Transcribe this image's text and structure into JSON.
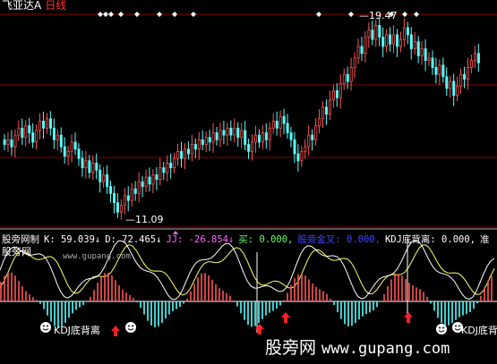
{
  "header": {
    "stock_name": "飞亚达A",
    "period": "日线"
  },
  "price": {
    "high_label": "19.47",
    "low_label": "11.09"
  },
  "indicator": {
    "name": "股旁网制",
    "k": "K: 59.039↓",
    "d": "D: 72.465↓",
    "jj": "JJ: -26.854↓",
    "buy": "买: 0.000,",
    "golden": "股旁金叉: 0.000,",
    "diverge": "KDJ底背离: 0.000,",
    "trail": "准",
    "sub_title": "股旁网",
    "site": "www.gupang.com"
  },
  "signals": {
    "left_label": "KDJ底背离",
    "right_label": "KDJ底背"
  },
  "watermark": {
    "cn": "股旁网",
    "url": "www.gupang.com"
  },
  "colors": {
    "up": "#ff5555",
    "down": "#55ffff",
    "k_line": "#ffffff",
    "d_line": "#ffff66",
    "grid": "#8b0000",
    "k_text": "#ffffff",
    "d_text": "#ffffff",
    "jj_text": "#ff66ff",
    "buy_text": "#66ff66",
    "golden_text": "#4444ff",
    "diverge_text": "#ffffff"
  },
  "chart_data": {
    "type": "candlestick",
    "price_high": 19.47,
    "price_low": 11.09,
    "closes": [
      14.2,
      14.4,
      14.1,
      14.6,
      14.9,
      14.5,
      15.0,
      14.7,
      14.3,
      14.8,
      15.2,
      14.9,
      15.3,
      14.9,
      14.4,
      14.6,
      14.1,
      13.7,
      13.9,
      14.3,
      14.0,
      13.6,
      13.2,
      13.5,
      13.0,
      13.4,
      13.1,
      12.6,
      12.9,
      12.4,
      12.1,
      11.7,
      11.3,
      11.6,
      12.0,
      11.8,
      12.3,
      12.1,
      12.6,
      12.4,
      12.8,
      12.5,
      12.9,
      12.7,
      13.2,
      13.0,
      13.4,
      13.2,
      13.6,
      13.9,
      13.6,
      14.0,
      13.8,
      14.2,
      14.0,
      14.4,
      14.2,
      14.5,
      14.3,
      14.7,
      14.4,
      14.8,
      14.6,
      14.9,
      14.6,
      14.9,
      14.5,
      14.8,
      14.2,
      13.9,
      14.3,
      14.6,
      14.3,
      14.7,
      14.4,
      14.9,
      15.2,
      14.9,
      15.4,
      15.1,
      14.7,
      14.4,
      13.8,
      13.5,
      13.9,
      14.1,
      14.6,
      14.4,
      15.0,
      15.3,
      15.8,
      15.5,
      16.1,
      16.5,
      16.2,
      16.8,
      17.2,
      16.9,
      17.5,
      17.9,
      18.4,
      18.1,
      18.8,
      19.1,
      18.7,
      19.3,
      18.8,
      18.4,
      18.9,
      18.5,
      18.9,
      18.4,
      18.7,
      19.2,
      18.9,
      18.3,
      18.6,
      18.0,
      18.3,
      17.8,
      17.9,
      17.5,
      17.2,
      17.6,
      17.1,
      16.6,
      16.9,
      16.3,
      16.7,
      17.2,
      17.0,
      17.5,
      17.8,
      18.1,
      17.7
    ]
  }
}
